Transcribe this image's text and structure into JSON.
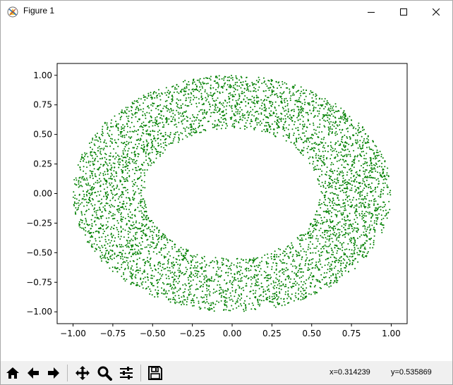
{
  "window": {
    "title": "Figure 1"
  },
  "icons": {
    "app": "figure-icon",
    "minimize": "minimize-icon",
    "maximize": "maximize-icon",
    "close": "close-icon"
  },
  "toolbar": {
    "buttons": [
      "home-icon",
      "back-arrow-icon",
      "forward-arrow-icon",
      "pan-icon",
      "zoom-icon",
      "configure-subplots-icon",
      "save-icon"
    ],
    "coord_x": "x=0.314239",
    "coord_y": "y=0.535869"
  },
  "colors": {
    "points": "#008000",
    "toolbar_bg": "#f0f0f0"
  },
  "chart_data": {
    "type": "scatter",
    "title": "",
    "xlabel": "",
    "ylabel": "",
    "xlim": [
      -1.1,
      1.1
    ],
    "ylim": [
      -1.1,
      1.1
    ],
    "xticks": [
      "−1.00",
      "−0.75",
      "−0.50",
      "−0.25",
      "0.00",
      "0.25",
      "0.50",
      "0.75",
      "1.00"
    ],
    "yticks": [
      "−1.00",
      "−0.75",
      "−0.50",
      "−0.25",
      "0.00",
      "0.25",
      "0.50",
      "0.75",
      "1.00"
    ],
    "xtick_values": [
      -1.0,
      -0.75,
      -0.5,
      -0.25,
      0.0,
      0.25,
      0.5,
      0.75,
      1.0
    ],
    "ytick_values": [
      -1.0,
      -0.75,
      -0.5,
      -0.25,
      0.0,
      0.25,
      0.5,
      0.75,
      1.0
    ],
    "grid": false,
    "series": [
      {
        "marker_color": "#008000",
        "distribution": "uniform-annulus",
        "inner_radius": 0.55,
        "outer_radius": 1.0,
        "point_count": 5000
      }
    ]
  }
}
